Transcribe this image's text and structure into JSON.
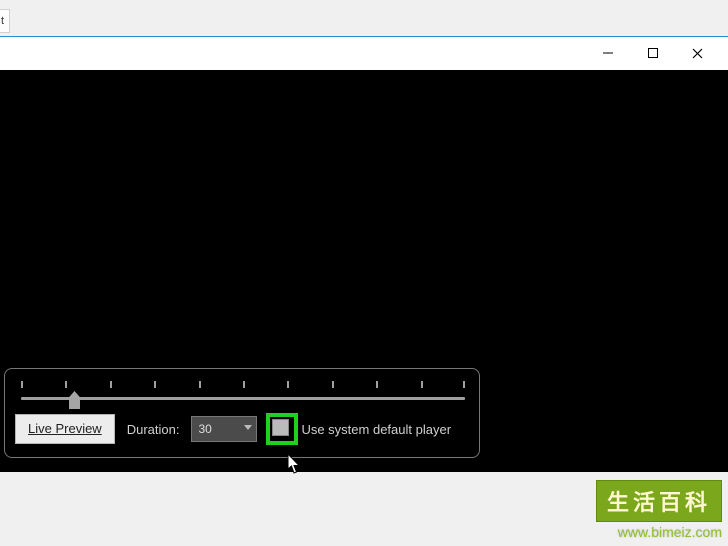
{
  "ribbon": {
    "tab_fragment": "t"
  },
  "window_controls": {
    "minimize": "minimize",
    "maximize": "maximize",
    "close": "close"
  },
  "panel": {
    "live_preview_label": "Live Preview",
    "duration_label": "Duration:",
    "duration_value": "30",
    "use_default_label": "Use system default player",
    "slider": {
      "min": 0,
      "max": 100,
      "value": 11,
      "tick_count": 11
    }
  },
  "watermark": {
    "title": "生活百科",
    "url": "www.bimeiz.com"
  },
  "colors": {
    "highlight_green": "#1fd11f",
    "panel_border": "#777777",
    "text_light": "#d0d0d0"
  }
}
